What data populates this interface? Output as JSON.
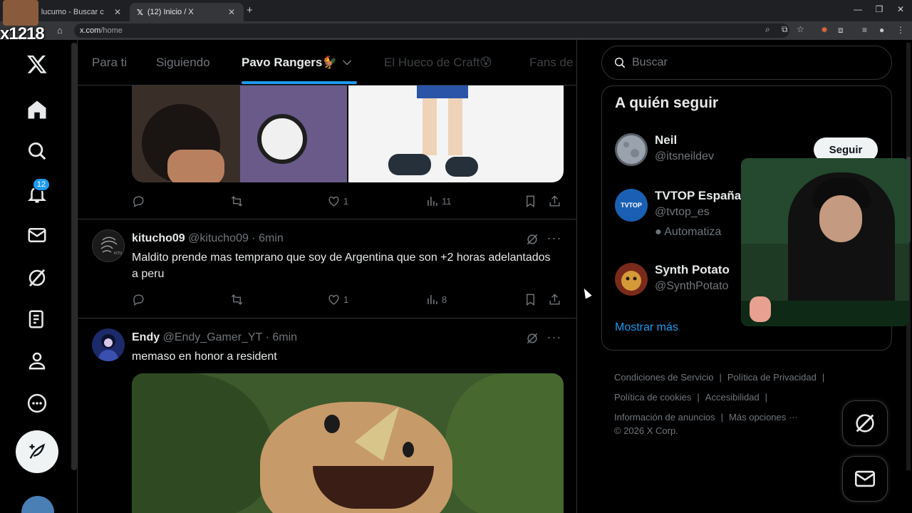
{
  "browser": {
    "tabs": [
      {
        "title": "lomas de lucumo - Buscar c",
        "active": false
      },
      {
        "title": "(12) Inicio / X",
        "active": true
      }
    ],
    "url_host": "x.com",
    "url_path": "/home",
    "streamer_tag": "x1218"
  },
  "nav": {
    "notification_count": "12",
    "icons": [
      "x-logo-icon",
      "home-icon",
      "search-icon",
      "bell-icon",
      "mail-icon",
      "grok-icon",
      "lists-icon",
      "profile-icon",
      "more-icon",
      "post-feather-icon"
    ]
  },
  "timeline": {
    "tabs": [
      {
        "label": "Para ti",
        "active": false
      },
      {
        "label": "Siguiendo",
        "active": false
      },
      {
        "label": "Pavo Rangers🐓",
        "active": true
      },
      {
        "label": "El Hueco de Craft😰",
        "active": false
      },
      {
        "label": "Fans de",
        "active": false
      }
    ],
    "top_post_stats": {
      "likes": "1",
      "views": "11"
    },
    "tweets": [
      {
        "name": "kitucho09",
        "handle": "@kitucho09",
        "time": "6min",
        "text": "Maldito prende mas temprano que soy de Argentina  que son +2 horas adelantados a peru",
        "likes": "1",
        "views": "8",
        "avatar_label": "KITU"
      },
      {
        "name": "Endy",
        "handle": "@Endy_Gamer_YT",
        "time": "6min",
        "text": "memaso en honor a resident"
      }
    ]
  },
  "sidebar": {
    "search_placeholder": "Buscar",
    "who_to_follow_title": "A quién seguir",
    "follow_label": "Seguir",
    "suggestions": [
      {
        "name": "Neil",
        "handle": "@itsneildev",
        "extra": ""
      },
      {
        "name": "TVTOP España",
        "handle": "@tvtop_es",
        "extra": "Automatiza",
        "avatar_text": "TVTOP"
      },
      {
        "name": "Synth Potato",
        "handle": "@SynthPotato",
        "extra": ""
      }
    ],
    "show_more": "Mostrar más",
    "footer": {
      "links": [
        "Condiciones de Servicio",
        "Política de Privacidad",
        "Política de cookies",
        "Accesibilidad",
        "Información de anuncios",
        "Más opciones ···"
      ],
      "copyright": "© 2026 X Corp."
    }
  },
  "colors": {
    "accent": "#1d9bf0",
    "background": "#000000",
    "text": "#e7e9ea",
    "muted": "#71767b",
    "border": "#2f3336"
  }
}
